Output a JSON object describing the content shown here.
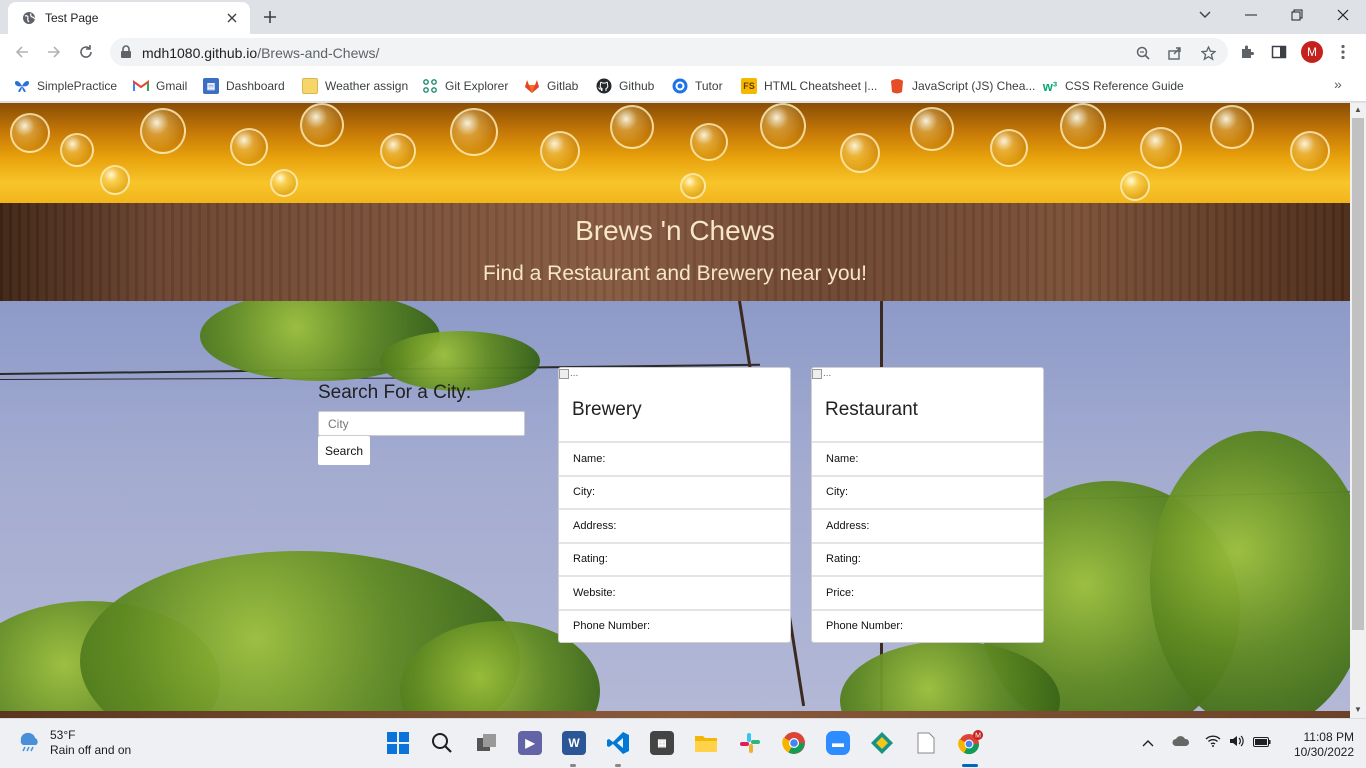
{
  "browser": {
    "tab_title": "Test Page",
    "url_host": "mdh1080.github.io",
    "url_path": "/Brews-and-Chews/",
    "profile_initial": "M",
    "bookmarks": [
      {
        "label": "SimplePractice",
        "icon": "butterfly-icon",
        "color": "#2a6fdb"
      },
      {
        "label": "Gmail",
        "icon": "gmail-icon",
        "color": "#ea4335"
      },
      {
        "label": "Dashboard",
        "icon": "dashboard-icon",
        "color": "#3b6fc4"
      },
      {
        "label": "Weather assign",
        "icon": "note-icon",
        "color": "#f6d66b"
      },
      {
        "label": "Git Explorer",
        "icon": "git-explorer-icon",
        "color": "#1a8a6a"
      },
      {
        "label": "Gitlab",
        "icon": "gitlab-icon",
        "color": "#e24329"
      },
      {
        "label": "Github",
        "icon": "github-icon",
        "color": "#24292e"
      },
      {
        "label": "Tutor",
        "icon": "tutor-icon",
        "color": "#1e73e8"
      },
      {
        "label": "HTML Cheatsheet |...",
        "icon": "fs-icon",
        "color": "#f5b800"
      },
      {
        "label": "JavaScript (JS) Chea...",
        "icon": "js-icon",
        "color": "#e44d26"
      },
      {
        "label": "CSS Reference Guide",
        "icon": "w3-icon",
        "color": "#04aa6d"
      }
    ]
  },
  "page": {
    "title": "Brews 'n Chews",
    "subtitle": "Find a Restaurant and Brewery near you!",
    "search": {
      "label": "Search For a City:",
      "placeholder": "City",
      "button": "Search"
    },
    "cards": [
      {
        "img_alt": "...",
        "title": "Brewery",
        "fields": [
          "Name:",
          "City:",
          "Address:",
          "Rating:",
          "Website:",
          "Phone Number:"
        ]
      },
      {
        "img_alt": "...",
        "title": "Restaurant",
        "fields": [
          "Name:",
          "City:",
          "Address:",
          "Rating:",
          "Price:",
          "Phone Number:"
        ]
      }
    ]
  },
  "taskbar": {
    "weather_temp": "53°F",
    "weather_desc": "Rain off and on",
    "time": "11:08 PM",
    "date": "10/30/2022",
    "apps": [
      "windows-start-icon",
      "search-icon",
      "task-view-icon",
      "teams-chat-icon",
      "word-icon",
      "vscode-icon",
      "calculator-icon",
      "file-explorer-icon",
      "slack-icon",
      "chrome-icon",
      "zoom-icon",
      "gitkraken-icon",
      "notepad-icon",
      "chrome-profile-icon"
    ]
  }
}
